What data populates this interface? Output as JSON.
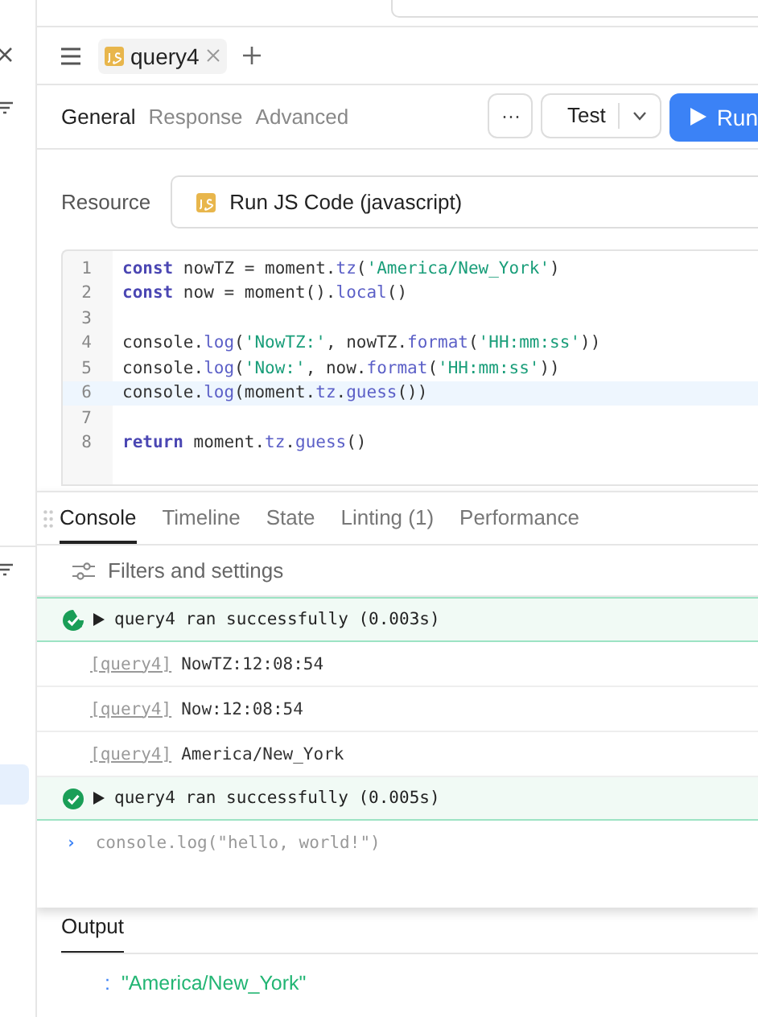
{
  "query_tabs": [
    {
      "label": "query4",
      "selected": true
    }
  ],
  "editor_tabs": [
    {
      "label": "General",
      "selected": true
    },
    {
      "label": "Response",
      "selected": false
    },
    {
      "label": "Advanced",
      "selected": false
    }
  ],
  "toolbar": {
    "more": "···",
    "test": "Test",
    "run": "Run"
  },
  "resource": {
    "label": "Resource",
    "value": "Run JS Code (javascript)"
  },
  "code": {
    "lines": [
      {
        "number": "1",
        "active": false,
        "tokens": [
          {
            "kind": "keyword",
            "text": "const"
          },
          {
            "kind": "plain",
            "text": " nowTZ = moment."
          },
          {
            "kind": "method",
            "text": "tz"
          },
          {
            "kind": "plain",
            "text": "("
          },
          {
            "kind": "string",
            "text": "'America/New_York'"
          },
          {
            "kind": "plain",
            "text": ")"
          }
        ]
      },
      {
        "number": "2",
        "active": false,
        "tokens": [
          {
            "kind": "keyword",
            "text": "const"
          },
          {
            "kind": "plain",
            "text": " now = moment()."
          },
          {
            "kind": "method",
            "text": "local"
          },
          {
            "kind": "plain",
            "text": "()"
          }
        ]
      },
      {
        "number": "3",
        "active": false
      },
      {
        "number": "4",
        "active": false,
        "tokens": [
          {
            "kind": "plain",
            "text": "console."
          },
          {
            "kind": "method",
            "text": "log"
          },
          {
            "kind": "plain",
            "text": "("
          },
          {
            "kind": "string",
            "text": "'NowTZ:'"
          },
          {
            "kind": "plain",
            "text": ", nowTZ."
          },
          {
            "kind": "method",
            "text": "format"
          },
          {
            "kind": "plain",
            "text": "("
          },
          {
            "kind": "string",
            "text": "'HH:mm:ss'"
          },
          {
            "kind": "plain",
            "text": "))"
          }
        ]
      },
      {
        "number": "5",
        "active": false,
        "tokens": [
          {
            "kind": "plain",
            "text": "console."
          },
          {
            "kind": "method",
            "text": "log"
          },
          {
            "kind": "plain",
            "text": "("
          },
          {
            "kind": "string",
            "text": "'Now:'"
          },
          {
            "kind": "plain",
            "text": ", now."
          },
          {
            "kind": "method",
            "text": "format"
          },
          {
            "kind": "plain",
            "text": "("
          },
          {
            "kind": "string",
            "text": "'HH:mm:ss'"
          },
          {
            "kind": "plain",
            "text": "))"
          }
        ]
      },
      {
        "number": "6",
        "active": true,
        "tokens": [
          {
            "kind": "plain",
            "text": "console."
          },
          {
            "kind": "method",
            "text": "log"
          },
          {
            "kind": "plain",
            "text": "(moment."
          },
          {
            "kind": "method",
            "text": "tz"
          },
          {
            "kind": "plain",
            "text": "."
          },
          {
            "kind": "method",
            "text": "guess"
          },
          {
            "kind": "plain",
            "text": "())"
          }
        ]
      },
      {
        "number": "7",
        "active": false
      },
      {
        "number": "8",
        "active": false,
        "tokens": [
          {
            "kind": "keyword",
            "text": "return"
          },
          {
            "kind": "plain",
            "text": " moment."
          },
          {
            "kind": "method",
            "text": "tz"
          },
          {
            "kind": "plain",
            "text": "."
          },
          {
            "kind": "method",
            "text": "guess"
          },
          {
            "kind": "plain",
            "text": "()"
          }
        ]
      }
    ]
  },
  "console": {
    "tabs": [
      {
        "label": "Console",
        "selected": true
      },
      {
        "label": "Timeline",
        "selected": false
      },
      {
        "label": "State",
        "selected": false
      },
      {
        "label": "Linting (1)",
        "selected": false
      },
      {
        "label": "Performance",
        "selected": false
      }
    ],
    "filters": "Filters and settings",
    "rows": [
      {
        "kind": "run",
        "done": false,
        "text": "query4 ran successfully (0.003s)"
      },
      {
        "kind": "log",
        "tag": "[query4]",
        "text": "NowTZ:12:08:54"
      },
      {
        "kind": "log",
        "tag": "[query4]",
        "text": "Now:12:08:54"
      },
      {
        "kind": "log",
        "tag": "[query4]",
        "text": "America/New_York"
      },
      {
        "kind": "run",
        "done": true,
        "text": "query4 ran successfully (0.005s)"
      }
    ],
    "prompt": "›",
    "input_placeholder": "console.log(\"hello, world!\")"
  },
  "output": {
    "title": "Output",
    "separator": ":",
    "value": "\"America/New_York\""
  }
}
